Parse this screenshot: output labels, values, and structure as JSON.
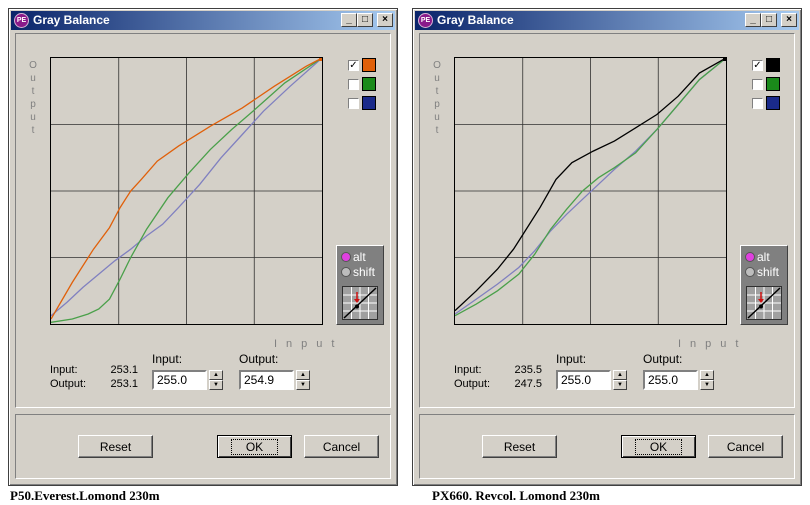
{
  "windows": [
    {
      "title": "Gray Balance",
      "icon_text": "PE",
      "y_axis_label": [
        "O",
        "u",
        "t",
        "p",
        "u",
        "t"
      ],
      "x_axis_label": "Input",
      "checkboxes": [
        {
          "checked": true,
          "color": "#e0600a"
        },
        {
          "checked": false,
          "color": "#1a8a1a"
        },
        {
          "checked": false,
          "color": "#1a2a8a"
        }
      ],
      "radios": [
        {
          "label": "alt",
          "on": true
        },
        {
          "label": "shift",
          "on": false
        }
      ],
      "readout": {
        "input_label": "Input:",
        "input_value": "253.1",
        "output_label": "Output:",
        "output_value": "253.1"
      },
      "input_field": {
        "label": "Input:",
        "value": "255.0"
      },
      "output_field": {
        "label": "Output:",
        "value": "254.9"
      },
      "buttons": {
        "reset": "Reset",
        "ok": "OK",
        "cancel": "Cancel"
      },
      "curves": [
        {
          "name": "orange",
          "color": "#e0600a",
          "points": [
            [
              0,
              3
            ],
            [
              20,
              25
            ],
            [
              40,
              45
            ],
            [
              55,
              58
            ],
            [
              65,
              70
            ],
            [
              75,
              80
            ],
            [
              85,
              87
            ],
            [
              100,
              98
            ],
            [
              120,
              107
            ],
            [
              150,
              119
            ],
            [
              180,
              130
            ],
            [
              210,
              143
            ],
            [
              240,
              155
            ],
            [
              255,
              160
            ]
          ]
        },
        {
          "name": "green",
          "color": "#4aa04a",
          "points": [
            [
              0,
              1
            ],
            [
              20,
              3
            ],
            [
              35,
              6
            ],
            [
              45,
              9
            ],
            [
              55,
              15
            ],
            [
              65,
              27
            ],
            [
              75,
              40
            ],
            [
              90,
              57
            ],
            [
              110,
              76
            ],
            [
              130,
              91
            ],
            [
              150,
              105
            ],
            [
              170,
              117
            ],
            [
              190,
              128
            ],
            [
              220,
              145
            ],
            [
              255,
              160
            ]
          ]
        },
        {
          "name": "blue",
          "color": "#8080c0",
          "points": [
            [
              0,
              5
            ],
            [
              15,
              13
            ],
            [
              30,
              22
            ],
            [
              45,
              30
            ],
            [
              60,
              38
            ],
            [
              75,
              45
            ],
            [
              90,
              53
            ],
            [
              105,
              60
            ],
            [
              120,
              70
            ],
            [
              140,
              84
            ],
            [
              160,
              100
            ],
            [
              180,
              114
            ],
            [
              200,
              128
            ],
            [
              225,
              143
            ],
            [
              255,
              160
            ]
          ]
        }
      ]
    },
    {
      "title": "Gray Balance",
      "icon_text": "PE",
      "y_axis_label": [
        "O",
        "u",
        "t",
        "p",
        "u",
        "t"
      ],
      "x_axis_label": "Input",
      "checkboxes": [
        {
          "checked": true,
          "color": "#000000"
        },
        {
          "checked": false,
          "color": "#1a8a1a"
        },
        {
          "checked": false,
          "color": "#1a2a8a"
        }
      ],
      "radios": [
        {
          "label": "alt",
          "on": true
        },
        {
          "label": "shift",
          "on": false
        }
      ],
      "readout": {
        "input_label": "Input:",
        "input_value": "235.5",
        "output_label": "Output:",
        "output_value": "247.5"
      },
      "input_field": {
        "label": "Input:",
        "value": "255.0"
      },
      "output_field": {
        "label": "Output:",
        "value": "255.0"
      },
      "buttons": {
        "reset": "Reset",
        "ok": "OK",
        "cancel": "Cancel"
      },
      "curves": [
        {
          "name": "black",
          "color": "#000000",
          "points": [
            [
              0,
              8
            ],
            [
              20,
              20
            ],
            [
              40,
              33
            ],
            [
              55,
              45
            ],
            [
              65,
              55
            ],
            [
              80,
              70
            ],
            [
              95,
              87
            ],
            [
              110,
              97
            ],
            [
              130,
              104
            ],
            [
              150,
              110
            ],
            [
              170,
              118
            ],
            [
              190,
              126
            ],
            [
              210,
              137
            ],
            [
              230,
              151
            ],
            [
              255,
              160
            ]
          ]
        },
        {
          "name": "green",
          "color": "#4aa04a",
          "points": [
            [
              0,
              5
            ],
            [
              20,
              12
            ],
            [
              40,
              20
            ],
            [
              60,
              30
            ],
            [
              75,
              42
            ],
            [
              90,
              57
            ],
            [
              105,
              69
            ],
            [
              120,
              80
            ],
            [
              135,
              88
            ],
            [
              150,
              94
            ],
            [
              170,
              103
            ],
            [
              190,
              117
            ],
            [
              210,
              132
            ],
            [
              230,
              147
            ],
            [
              255,
              160
            ]
          ]
        },
        {
          "name": "blue",
          "color": "#8080c0",
          "points": [
            [
              0,
              6
            ],
            [
              20,
              15
            ],
            [
              40,
              24
            ],
            [
              60,
              34
            ],
            [
              75,
              44
            ],
            [
              90,
              56
            ],
            [
              105,
              66
            ],
            [
              120,
              75
            ],
            [
              135,
              84
            ],
            [
              150,
              93
            ],
            [
              170,
              104
            ],
            [
              190,
              117
            ],
            [
              210,
              132
            ],
            [
              230,
              147
            ],
            [
              255,
              160
            ]
          ]
        }
      ]
    }
  ],
  "captions": [
    "P50.Everest.Lomond 230m",
    "PX660. Revcol. Lomond 230m"
  ]
}
